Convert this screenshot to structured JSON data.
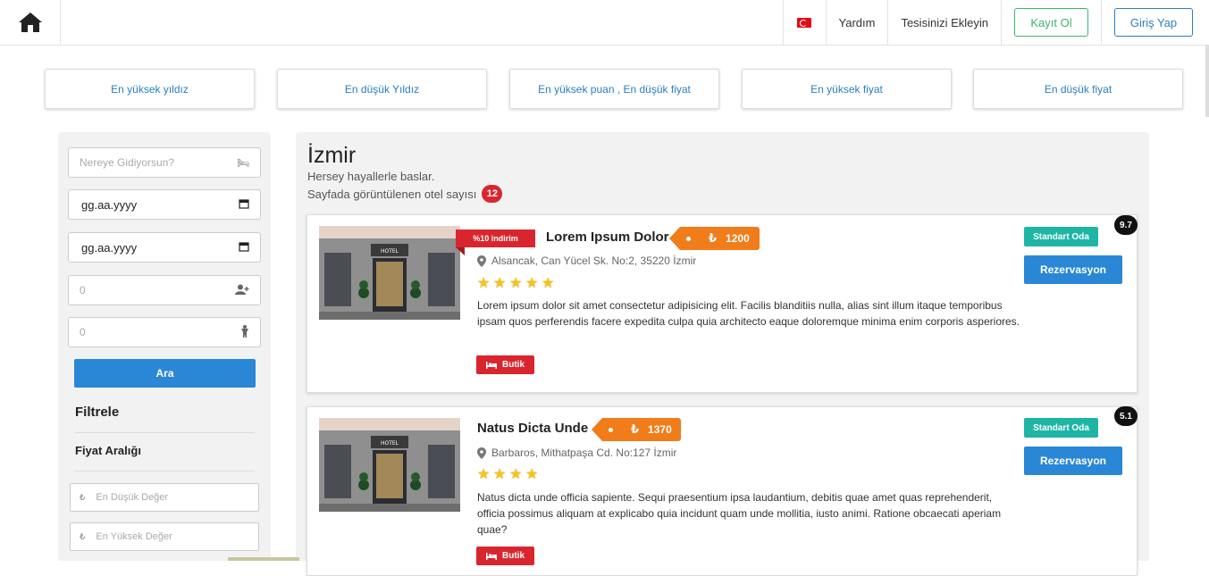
{
  "nav": {
    "flag_icon": "turkey-flag-icon",
    "help": "Yardım",
    "add_property": "Tesisinizi Ekleyin",
    "register": "Kayıt Ol",
    "login": "Giriş Yap"
  },
  "sort": [
    {
      "label": "En yüksek yıldız"
    },
    {
      "label": "En düşük Yıldız"
    },
    {
      "label": "En yüksek puan , En düşük fiyat"
    },
    {
      "label": "En yüksek fiyat"
    },
    {
      "label": "En düşük fiyat"
    }
  ],
  "search": {
    "destination_placeholder": "Nereye Gidiyorsun?",
    "checkin": "gg.aa.yyyy",
    "checkout": "gg.aa.yyyy",
    "adults": "0",
    "children": "0",
    "button": "Ara"
  },
  "filter": {
    "title": "Filtrele",
    "price_title": "Fiyat Aralığı",
    "min_placeholder": "En Düşük Değer",
    "max_placeholder": "En Yüksek Değer",
    "currency_symbol": "₺"
  },
  "main": {
    "city": "İzmir",
    "slogan": "Hersey hayallerle baslar.",
    "count_label": "Sayfada görüntülenen otel sayısı",
    "count": "12"
  },
  "hotels": [
    {
      "name": "Lorem Ipsum Dolor",
      "discount": "%10 indirim",
      "price": "1200",
      "currency": "₺",
      "address": "Alsancak, Can Yücel Sk. No:2, 35220 İzmir",
      "stars": 5,
      "description": "Lorem ipsum dolor sit amet consectetur adipisicing elit. Facilis blanditiis nulla, alias sint illum itaque temporibus ipsam quos perferendis facere expedita culpa quia architecto eaque doloremque minima enim corporis asperiores.",
      "type": "Butik",
      "room": "Standart Oda",
      "reserve": "Rezervasyon",
      "score": "9.7"
    },
    {
      "name": "Natus Dicta Unde",
      "price": "1370",
      "currency": "₺",
      "address": "Barbaros, Mithatpaşa Cd. No:127 İzmir",
      "stars": 4,
      "description": "Natus dicta unde officia sapiente. Sequi praesentium ipsa laudantium, debitis quae amet quas reprehenderit, officia possimus aliquam at explicabo quia incidunt quam unde mollitia, iusto animi. Ratione obcaecati aperiam quae?",
      "type": "Butik",
      "room": "Standart Oda",
      "reserve": "Rezervasyon",
      "score": "5.1"
    }
  ],
  "colors": {
    "primary": "#2a87d6",
    "danger": "#d9262e",
    "orange": "#f07c1a",
    "teal": "#1fb5a5",
    "green": "#3cb371"
  }
}
